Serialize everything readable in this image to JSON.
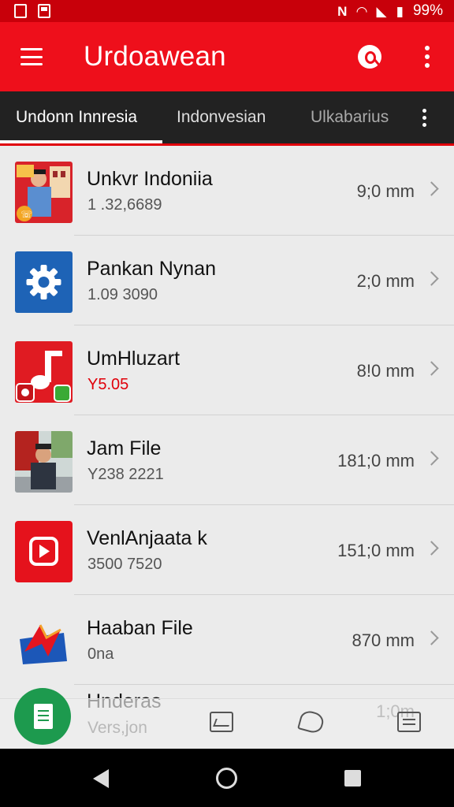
{
  "status_bar": {
    "battery": "99%",
    "icons": [
      "notification-icon",
      "gallery-icon",
      "nfc-icon",
      "wifi-icon",
      "signal-icon",
      "battery-icon"
    ]
  },
  "app_bar": {
    "title": "Urdoawean",
    "icons": [
      "menu-icon",
      "search-icon",
      "more-vert-icon"
    ]
  },
  "tabs": [
    {
      "label": "Undonn Innresia",
      "selected": true
    },
    {
      "label": "Indonvesian",
      "selected": false
    },
    {
      "label": "Ulkabarius",
      "selected": false
    }
  ],
  "list": [
    {
      "title": "Unkvr Indoniia",
      "subtitle": "1 .32,6689",
      "time": "9;0 mm",
      "thumb": "person-speaking-thumbnail"
    },
    {
      "title": "Pankan Nynan",
      "subtitle": "1.09 3090",
      "time": "2;0 mm",
      "thumb": "settings-gear-icon"
    },
    {
      "title": "UmHluzart",
      "subtitle": "Y5.05",
      "time": "8!0 mm",
      "thumb": "music-note-icon"
    },
    {
      "title": "Jam  File",
      "subtitle": "Y238 2221",
      "time": "181;0 mm",
      "thumb": "man-sitting-thumbnail"
    },
    {
      "title": "VenlAnjaata k",
      "subtitle": "3500 7520",
      "time": "151;0 mm",
      "thumb": "play-video-icon"
    },
    {
      "title": "Haaban File",
      "subtitle": "0na",
      "time": "870 mm",
      "thumb": "arrow-folder-icon"
    }
  ],
  "partial_row": {
    "title": "Hnderas",
    "subtitle": "Vers,jon",
    "time": "1;0m"
  },
  "bottom_nav": {
    "icons": [
      "document-icon",
      "image-icon",
      "tag-icon",
      "list-icon"
    ]
  },
  "colors": {
    "primary": "#ee0f1b",
    "status": "#c8000a",
    "tab_bg": "#222222",
    "fab": "#1d9a4e"
  }
}
